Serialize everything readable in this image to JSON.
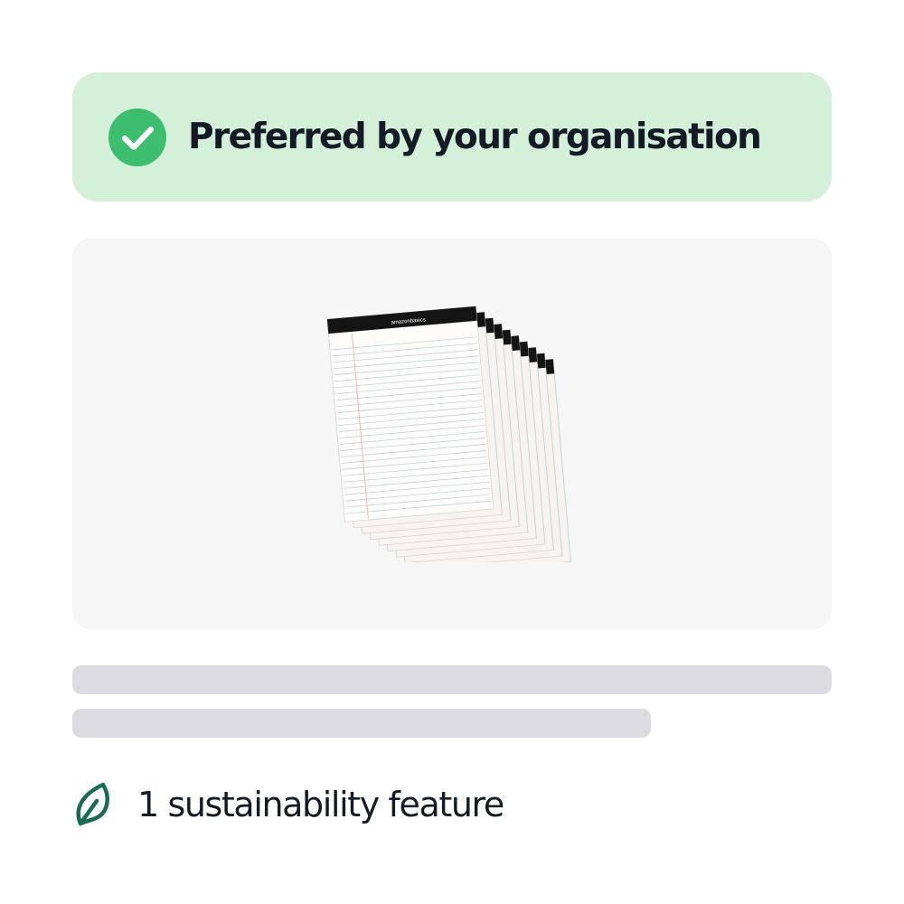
{
  "banner": {
    "text": "Preferred by your organisation",
    "icon": "check-circle-icon",
    "background": "#d4f0d9",
    "icon_color": "#3dbe6e",
    "text_color": "#141a26"
  },
  "product": {
    "image": "legal-pads-image",
    "brand_print": "amazonbasics",
    "panel_background": "#f6f6f6"
  },
  "skeleton_color": "#dcdce0",
  "feature": {
    "text": "1 sustainability feature",
    "icon": "leaf-icon",
    "icon_color": "#1a6b54",
    "text_color": "#141a26"
  }
}
